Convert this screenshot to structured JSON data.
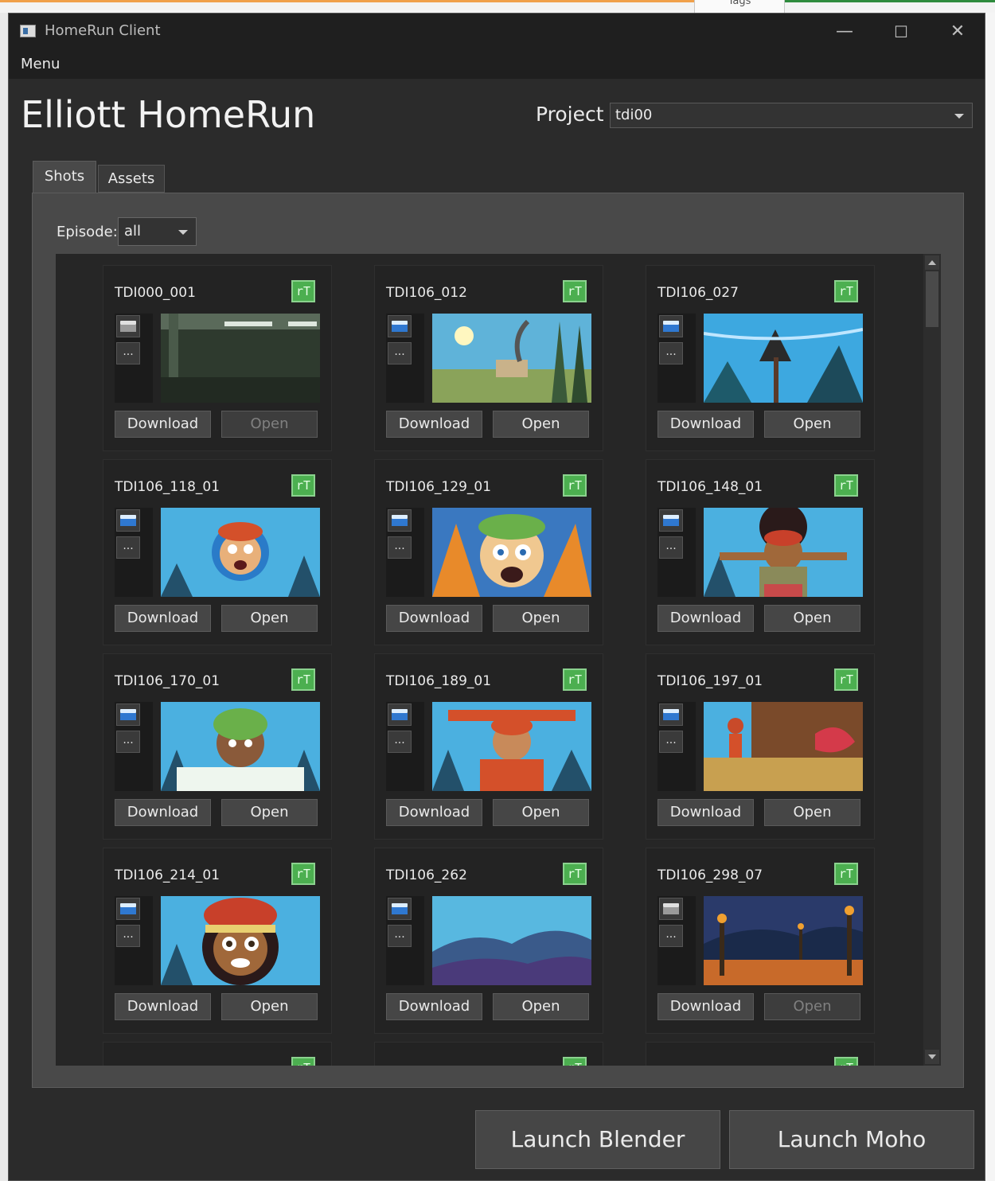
{
  "background": {
    "tab_label": "Tags"
  },
  "window": {
    "title": "HomeRun Client",
    "minimize": "—",
    "maximize": "☐",
    "close": "✕"
  },
  "menu": {
    "label": "Menu"
  },
  "header": {
    "title": "Elliott HomeRun",
    "project_label": "Project",
    "project_value": "tdi00"
  },
  "tabs": [
    {
      "label": "Shots"
    },
    {
      "label": "Assets"
    }
  ],
  "episode": {
    "label": "Episode:",
    "value": "all"
  },
  "buttons": {
    "download": "Download",
    "open": "Open",
    "more": "...",
    "rt": "rT"
  },
  "shots": [
    {
      "name": "TDI000_001",
      "open_enabled": false,
      "folder": "grey"
    },
    {
      "name": "TDI106_012",
      "open_enabled": true,
      "folder": "blue"
    },
    {
      "name": "TDI106_027",
      "open_enabled": true,
      "folder": "blue"
    },
    {
      "name": "TDI106_118_01",
      "open_enabled": true,
      "folder": "blue"
    },
    {
      "name": "TDI106_129_01",
      "open_enabled": true,
      "folder": "blue"
    },
    {
      "name": "TDI106_148_01",
      "open_enabled": true,
      "folder": "blue"
    },
    {
      "name": "TDI106_170_01",
      "open_enabled": true,
      "folder": "blue"
    },
    {
      "name": "TDI106_189_01",
      "open_enabled": true,
      "folder": "blue"
    },
    {
      "name": "TDI106_197_01",
      "open_enabled": true,
      "folder": "blue"
    },
    {
      "name": "TDI106_214_01",
      "open_enabled": true,
      "folder": "blue"
    },
    {
      "name": "TDI106_262",
      "open_enabled": true,
      "folder": "blue"
    },
    {
      "name": "TDI106_298_07",
      "open_enabled": false,
      "folder": "grey"
    }
  ],
  "footer": {
    "launch_blender": "Launch Blender",
    "launch_moho": "Launch Moho"
  },
  "colors": {
    "window_bg": "#2b2b2b",
    "panel_bg": "#494949",
    "accent_green": "#4caf50",
    "folder_blue": "#2f78d0"
  }
}
